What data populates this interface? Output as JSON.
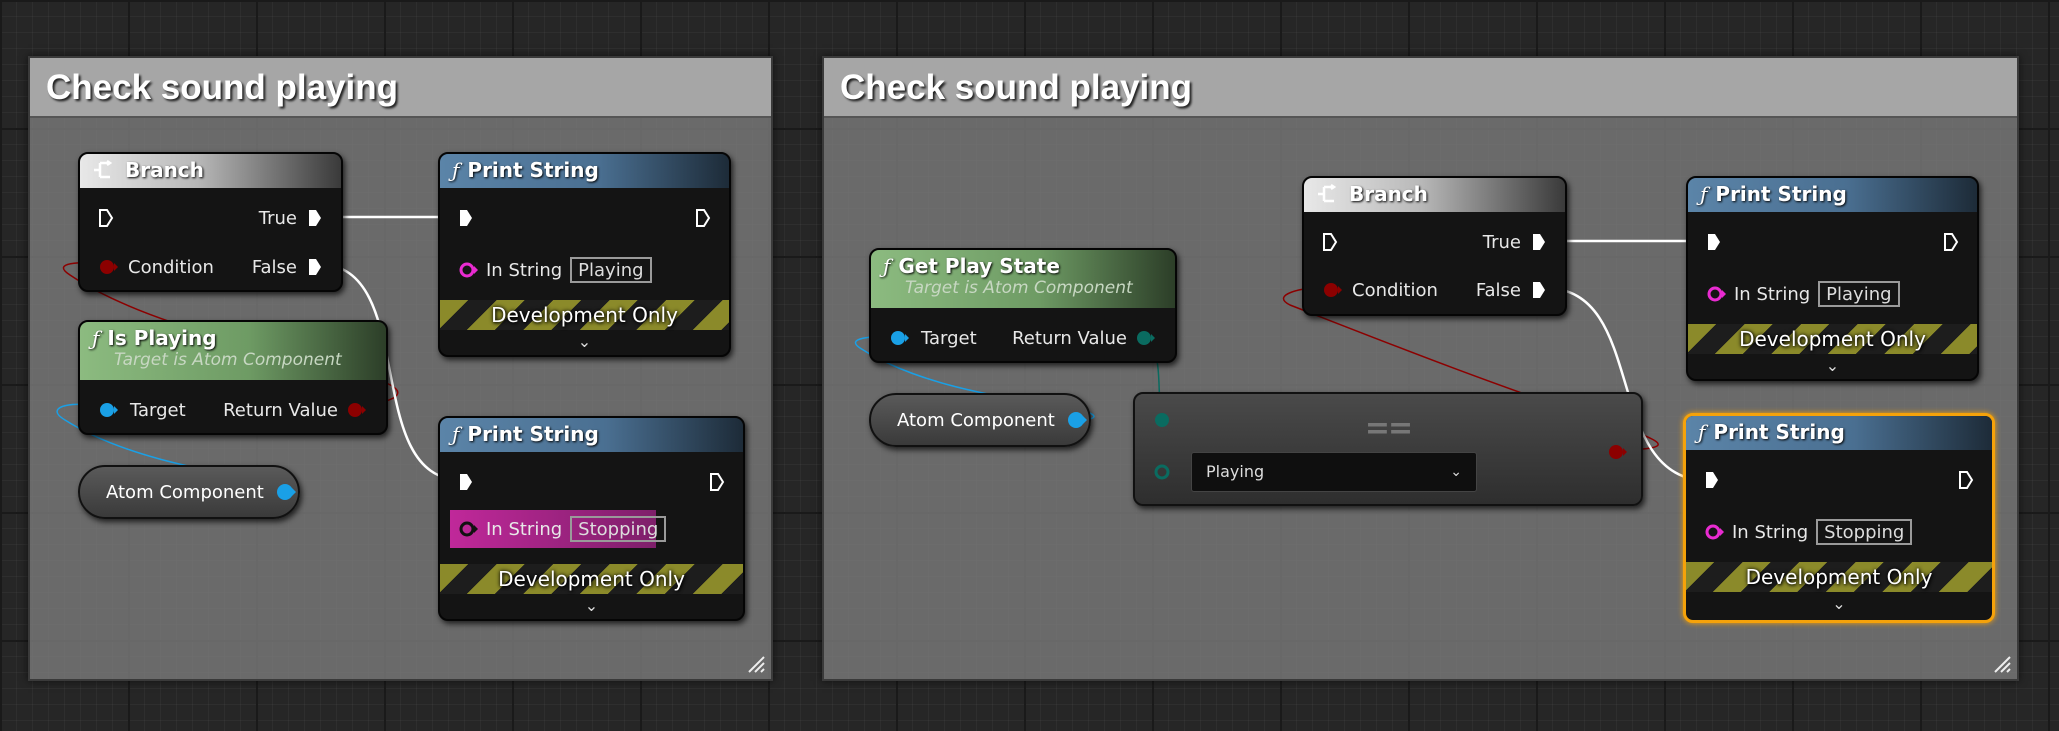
{
  "colors": {
    "exec": "#ffffff",
    "boolean": "#8c0000",
    "object": "#1aa0e6",
    "string": "#e92bd1",
    "enum": "#0a6b60",
    "selected_outline": "#f5a20a"
  },
  "left_graph": {
    "comment": "Check sound playing",
    "branch": {
      "title": "Branch",
      "true_label": "True",
      "false_label": "False",
      "condition_label": "Condition"
    },
    "is_playing": {
      "title": "Is Playing",
      "subtitle": "Target is Atom Component",
      "target_label": "Target",
      "return_label": "Return Value"
    },
    "print_playing": {
      "title": "Print String",
      "in_string_label": "In String",
      "in_string_value": "Playing",
      "dev_only": "Development Only"
    },
    "print_stopping": {
      "title": "Print String",
      "in_string_label": "In String",
      "in_string_value": "Stopping",
      "dev_only": "Development Only"
    },
    "atom_var": {
      "label": "Atom Component"
    }
  },
  "right_graph": {
    "comment": "Check sound playing",
    "branch": {
      "title": "Branch",
      "true_label": "True",
      "false_label": "False",
      "condition_label": "Condition"
    },
    "get_play_state": {
      "title": "Get Play State",
      "subtitle": "Target is Atom Component",
      "target_label": "Target",
      "return_label": "Return Value"
    },
    "atom_var": {
      "label": "Atom Component"
    },
    "equal_node": {
      "symbol": "==",
      "dropdown_value": "Playing"
    },
    "print_playing": {
      "title": "Print String",
      "in_string_label": "In String",
      "in_string_value": "Playing",
      "dev_only": "Development Only"
    },
    "print_stopping": {
      "title": "Print String",
      "in_string_label": "In String",
      "in_string_value": "Stopping",
      "dev_only": "Development Only"
    }
  },
  "icons": [
    "branch-icon",
    "function-icon",
    "exec-pin-icon",
    "data-pin-icon",
    "chevron-down-icon",
    "resize-grip-icon"
  ]
}
